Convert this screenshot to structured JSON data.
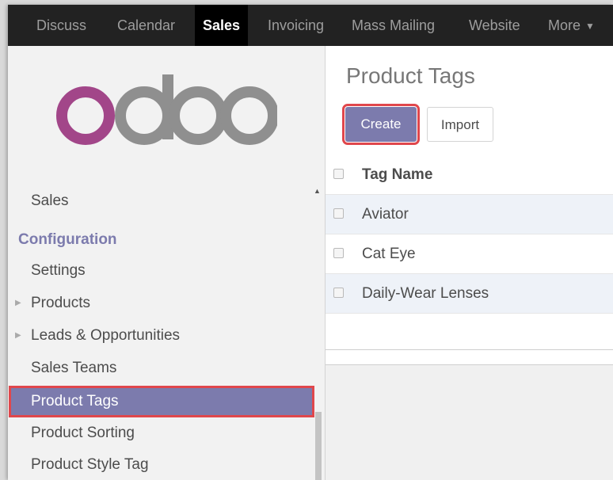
{
  "topbar": {
    "items": [
      {
        "label": "Discuss"
      },
      {
        "label": "Calendar"
      },
      {
        "label": "Sales"
      },
      {
        "label": "Invoicing"
      },
      {
        "label": "Mass Mailing"
      },
      {
        "label": "Website"
      },
      {
        "label": "More"
      }
    ],
    "active": "Sales"
  },
  "sidebar": {
    "logo_text": "odoo",
    "top_item": "Sales",
    "section": "Configuration",
    "items": [
      {
        "label": "Settings",
        "expandable": false
      },
      {
        "label": "Products",
        "expandable": true
      },
      {
        "label": "Leads & Opportunities",
        "expandable": true
      },
      {
        "label": "Sales Teams",
        "expandable": false
      },
      {
        "label": "Product Tags",
        "expandable": false,
        "active": true
      },
      {
        "label": "Product Sorting",
        "expandable": false
      },
      {
        "label": "Product Style Tag",
        "expandable": false
      }
    ]
  },
  "main": {
    "title": "Product Tags",
    "create_label": "Create",
    "import_label": "Import",
    "table": {
      "header": "Tag Name",
      "rows": [
        "Aviator",
        "Cat Eye",
        "Daily-Wear Lenses"
      ]
    }
  },
  "colors": {
    "accent": "#7c7bad",
    "highlight": "#e0474c",
    "topbar": "#222222"
  }
}
